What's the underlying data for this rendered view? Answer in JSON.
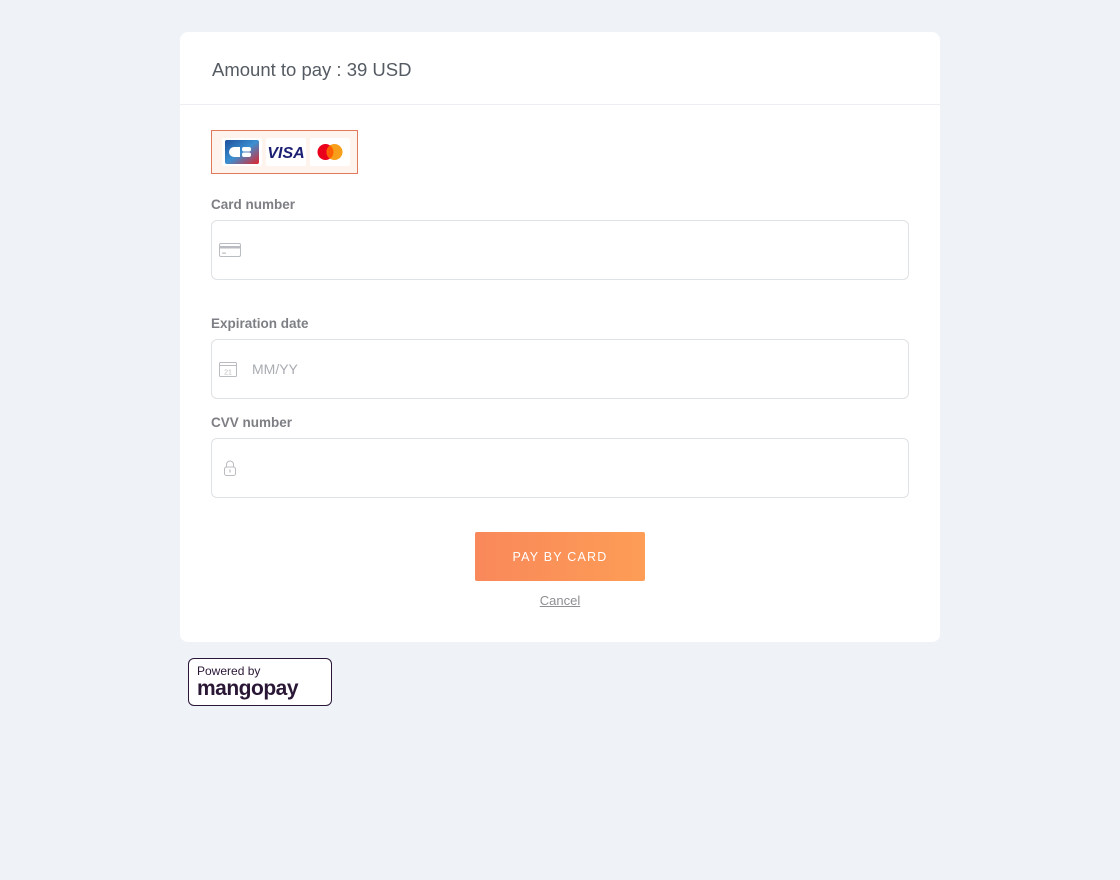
{
  "header": {
    "title": "Amount to pay : 39 USD"
  },
  "card_logos": [
    {
      "name": "CB",
      "icon": "cb-card-icon"
    },
    {
      "name": "VISA",
      "icon": "visa-icon",
      "color": "#1a1f71"
    },
    {
      "name": "Mastercard",
      "icon": "mastercard-icon",
      "colors": [
        "#eb001b",
        "#f79e1b"
      ]
    }
  ],
  "fields": {
    "card_number": {
      "label": "Card number",
      "value": "",
      "placeholder": "",
      "icon": "credit-card-icon"
    },
    "expiration": {
      "label": "Expiration date",
      "value": "",
      "placeholder": "MM/YY",
      "icon": "calendar-icon",
      "icon_text": "21"
    },
    "cvv": {
      "label": "CVV number",
      "value": "",
      "placeholder": "",
      "icon": "lock-icon"
    }
  },
  "actions": {
    "pay_label": "PAY BY CARD",
    "cancel_label": "Cancel"
  },
  "footer": {
    "powered_by": "Powered by",
    "brand": "mangopay"
  },
  "colors": {
    "background": "#eff2f7",
    "accent_start": "#f9885a",
    "accent_end": "#fd9d56",
    "brand_dark": "#2a1736"
  }
}
